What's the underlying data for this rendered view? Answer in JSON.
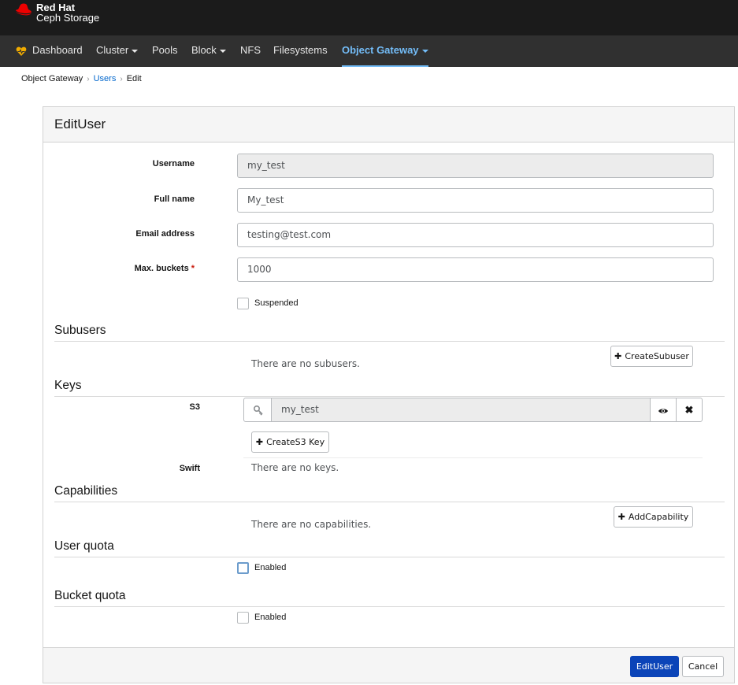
{
  "brand": {
    "line1": "Red Hat",
    "line2": "Ceph Storage"
  },
  "nav": {
    "dashboard": "Dashboard",
    "cluster": "Cluster",
    "pools": "Pools",
    "block": "Block",
    "nfs": "NFS",
    "filesystems": "Filesystems",
    "object_gateway": "Object Gateway"
  },
  "breadcrumb": {
    "root": "Object Gateway",
    "users": "Users",
    "current": "Edit"
  },
  "form": {
    "title": "EditUser",
    "username_label": "Username",
    "username_value": "my_test",
    "fullname_label": "Full name",
    "fullname_value": "My_test",
    "email_label": "Email address",
    "email_value": "testing@test.com",
    "maxbuckets_label": "Max. buckets",
    "maxbuckets_required": "*",
    "maxbuckets_value": "1000",
    "suspended_label": "Suspended"
  },
  "subusers": {
    "heading": "Subusers",
    "empty": "There are no subusers.",
    "create_button": "CreateSubuser"
  },
  "keys": {
    "heading": "Keys",
    "s3_label": "S3",
    "s3_value": "my_test",
    "create_s3_button": "CreateS3 Key",
    "swift_label": "Swift",
    "swift_empty": "There are no keys."
  },
  "capabilities": {
    "heading": "Capabilities",
    "empty": "There are no capabilities.",
    "add_button": "AddCapability"
  },
  "user_quota": {
    "heading": "User quota",
    "enabled_label": "Enabled"
  },
  "bucket_quota": {
    "heading": "Bucket quota",
    "enabled_label": "Enabled"
  },
  "footer": {
    "submit": "EditUser",
    "cancel": "Cancel"
  },
  "colors": {
    "primary": "#0b44b8",
    "nav_active": "#73bcf7",
    "topbar": "#1b1b1b",
    "navbar": "#303030",
    "required": "#c9190b"
  }
}
